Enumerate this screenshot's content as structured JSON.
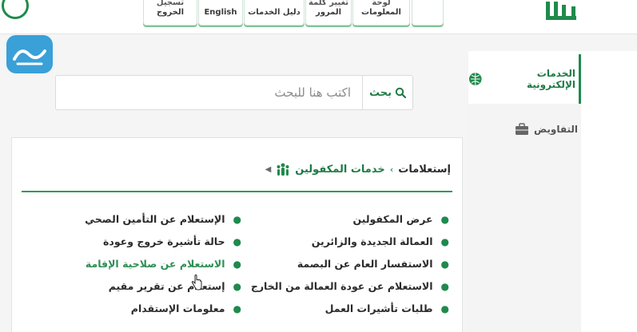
{
  "topnav": {
    "logout": [
      "تسجيل",
      "الخروج"
    ],
    "english": "English",
    "services_guide": "دليل الخدمات",
    "change_password": [
      "تغيير كلمة",
      "المرور"
    ],
    "info_board": [
      "لوحة",
      "المعلومات"
    ]
  },
  "search": {
    "button_label": "بحث",
    "placeholder": "اكتب هنا للبحث"
  },
  "sidebar": {
    "items": [
      {
        "label": "الخدمات الإلكترونية",
        "active": true
      },
      {
        "label": "التفاويض",
        "active": false
      }
    ]
  },
  "breadcrumb": {
    "root": "خدمات المكفولين",
    "current": "إستعلامات"
  },
  "services": {
    "right_column": [
      "عرض المكفولين",
      "العمالة الجديدة والزائرين",
      "الاستفسار العام عن البصمة",
      "الاستعلام عن عودة العمالة من الخارج",
      "طلبات تأشيرات العمل"
    ],
    "left_column": [
      "الإستعلام عن التأمين الصحي",
      "حالة تأشيرة خروج وعودة",
      "الاستعلام عن صلاحية الإقامة",
      "إستعلام عن تقرير مقيم",
      "معلومات الإستقدام"
    ],
    "highlighted": "الاستعلام عن صلاحية الإقامة"
  },
  "colors": {
    "accent": "#1f7a45",
    "rule": "#2e9c55",
    "watermark": "#3aa0d8"
  }
}
